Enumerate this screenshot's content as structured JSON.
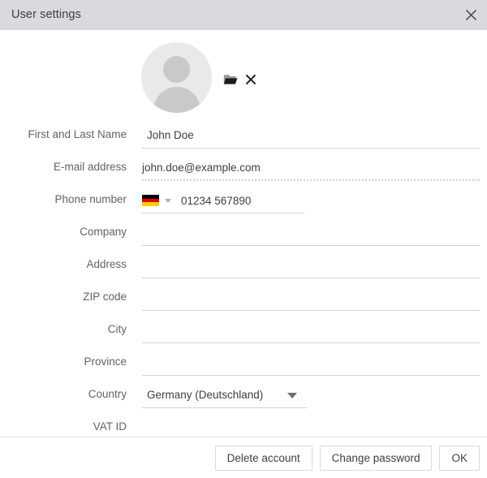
{
  "window": {
    "title": "User settings",
    "close_icon": "close-icon"
  },
  "avatar": {
    "icon": "user-avatar-placeholder",
    "browse_icon": "folder-open-icon",
    "remove_icon": "remove-x-icon"
  },
  "form": {
    "fields": [
      {
        "label": "First and Last Name",
        "name": "first-and-last-name",
        "value": "John Doe",
        "type": "text",
        "underline": "solid"
      },
      {
        "label": "E-mail address",
        "name": "email-address",
        "value": "john.doe@example.com",
        "type": "text",
        "underline": "dotted"
      },
      {
        "label": "Phone number",
        "name": "phone-number",
        "value": "01234 567890",
        "type": "phone",
        "country_flag": "germany-flag",
        "underline": "solid"
      },
      {
        "label": "Company",
        "name": "company",
        "value": "",
        "type": "text",
        "underline": "solid"
      },
      {
        "label": "Address",
        "name": "address",
        "value": "",
        "type": "text",
        "underline": "solid"
      },
      {
        "label": "ZIP code",
        "name": "zip-code",
        "value": "",
        "type": "text",
        "underline": "solid"
      },
      {
        "label": "City",
        "name": "city",
        "value": "",
        "type": "text",
        "underline": "solid"
      },
      {
        "label": "Province",
        "name": "province",
        "value": "",
        "type": "text",
        "underline": "solid"
      },
      {
        "label": "Country",
        "name": "country",
        "value": "Germany (Deutschland)",
        "type": "select",
        "underline": "solid"
      },
      {
        "label": "VAT ID",
        "name": "vat-id",
        "value": "",
        "type": "text",
        "underline": "solid"
      }
    ]
  },
  "footer": {
    "delete_account": "Delete account",
    "change_password": "Change password",
    "ok": "OK"
  },
  "colors": {
    "titlebar_bg": "#d9dade",
    "underline": "#d2d2d2",
    "label_text": "#5f6368",
    "value_text": "#3c4043",
    "button_border": "#dadce0",
    "flag_black": "#000000",
    "flag_red": "#dd0000",
    "flag_gold": "#ffce00"
  }
}
